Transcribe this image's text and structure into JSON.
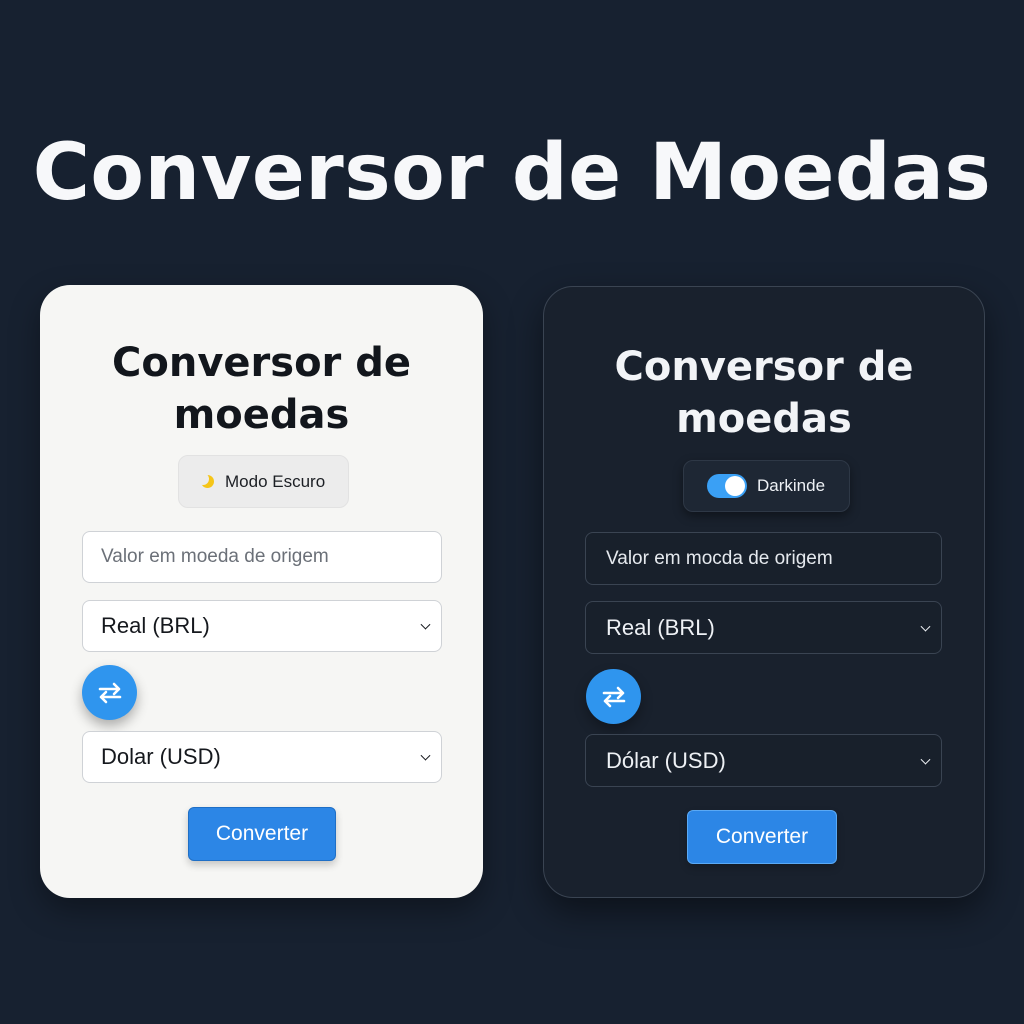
{
  "page": {
    "title": "Conversor de Moedas"
  },
  "light_card": {
    "title": "Conversor de moedas",
    "mode_toggle_label": "Modo Escuro",
    "amount_placeholder": "Valor em moeda de origem",
    "from_currency": "Real (BRL)",
    "to_currency": "Dolar (USD)",
    "convert_label": "Converter"
  },
  "dark_card": {
    "title": "Conversor de moedas",
    "mode_toggle_label": "Darkinde",
    "amount_placeholder": "Valor em mocda de origem",
    "from_currency": "Real (BRL)",
    "to_currency": "Dólar (USD)",
    "convert_label": "Converter"
  },
  "icons": {
    "moon": "moon-icon",
    "swap": "swap-arrows-icon",
    "dropdown": "chevron-down-icon"
  },
  "colors": {
    "background": "#172130",
    "accent": "#2f95ee",
    "light_card": "#f6f6f4",
    "dark_card": "#19212d",
    "toggle_on": "#3aa0f5",
    "moon": "#f5c518"
  }
}
